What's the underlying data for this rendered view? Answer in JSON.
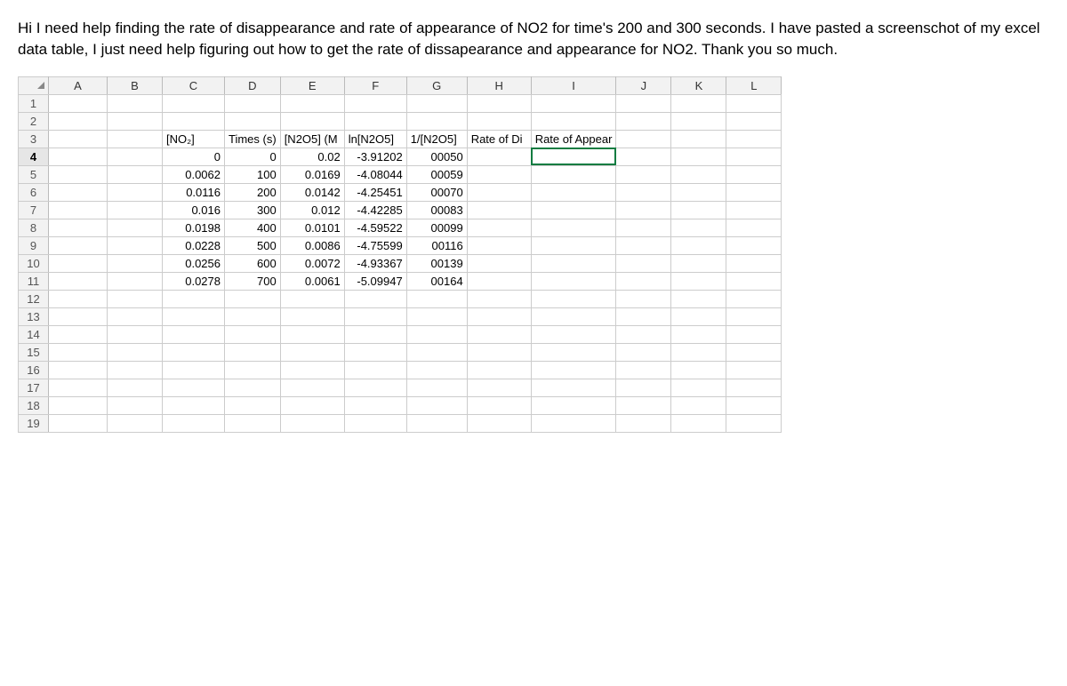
{
  "question": "Hi I need help finding the rate of disappearance and rate of appearance of NO2 for time's 200 and 300 seconds. I have pasted a screenschot of my excel data table, I just need help figuring out how to get the rate of dissapearance and appearance for NO2. Thank you so much.",
  "columns": [
    "A",
    "B",
    "C",
    "D",
    "E",
    "F",
    "G",
    "H",
    "I",
    "J",
    "K",
    "L"
  ],
  "row_count": 19,
  "headers_row": 3,
  "headers": {
    "C": "[NO₂]",
    "D": "Times (s)",
    "E": "[N2O5] (M",
    "F": "ln[N2O5]",
    "G": "1/[N2O5]",
    "H": "Rate of Di",
    "I": "Rate of Appear"
  },
  "data_rows": [
    {
      "row": 4,
      "C": "0",
      "D": "0",
      "E": "0.02",
      "F": "-3.91202",
      "G": "00050"
    },
    {
      "row": 5,
      "C": "0.0062",
      "D": "100",
      "E": "0.0169",
      "F": "-4.08044",
      "G": "00059"
    },
    {
      "row": 6,
      "C": "0.0116",
      "D": "200",
      "E": "0.0142",
      "F": "-4.25451",
      "G": "00070"
    },
    {
      "row": 7,
      "C": "0.016",
      "D": "300",
      "E": "0.012",
      "F": "-4.42285",
      "G": "00083"
    },
    {
      "row": 8,
      "C": "0.0198",
      "D": "400",
      "E": "0.0101",
      "F": "-4.59522",
      "G": "00099"
    },
    {
      "row": 9,
      "C": "0.0228",
      "D": "500",
      "E": "0.0086",
      "F": "-4.75599",
      "G": "00116"
    },
    {
      "row": 10,
      "C": "0.0256",
      "D": "600",
      "E": "0.0072",
      "F": "-4.93367",
      "G": "00139"
    },
    {
      "row": 11,
      "C": "0.0278",
      "D": "700",
      "E": "0.0061",
      "F": "-5.09947",
      "G": "00164"
    }
  ],
  "active_cell": {
    "row": 4,
    "col": "I"
  },
  "selected_row_header": 4
}
